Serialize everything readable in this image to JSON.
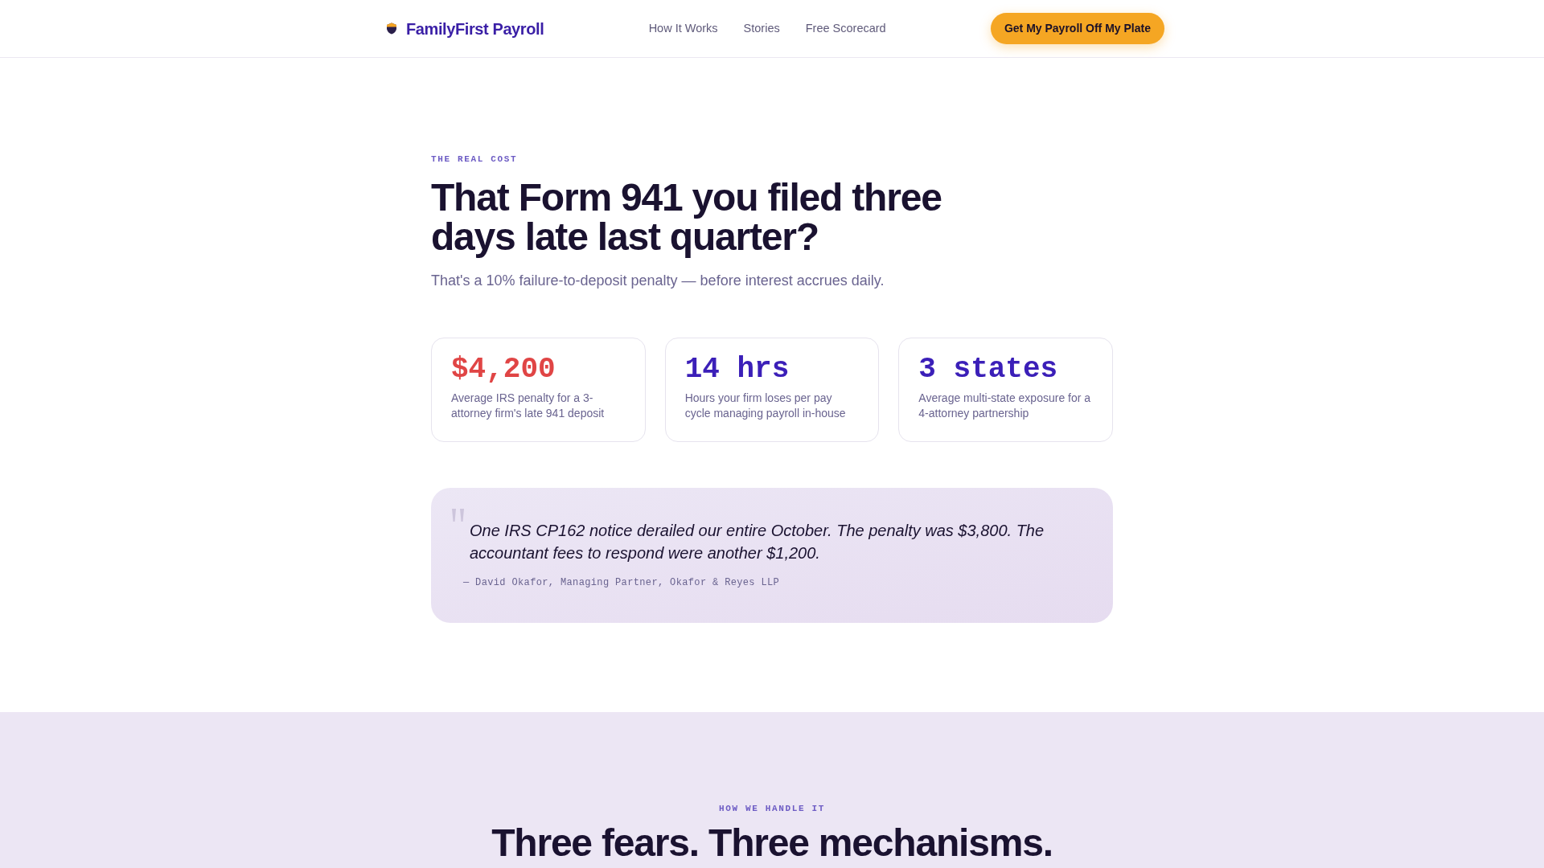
{
  "header": {
    "brand": "FamilyFirst Payroll",
    "nav": [
      "How It Works",
      "Stories",
      "Free Scorecard"
    ],
    "cta": "Get My Payroll Off My Plate"
  },
  "hero": {
    "eyebrow": "THE REAL COST",
    "title": "That Form 941 you filed three days late last quarter?",
    "subtitle": "That's a 10% failure-to-deposit penalty — before interest accrues daily."
  },
  "stats": [
    {
      "value": "$4,200",
      "caption": "Average IRS penalty for a 3-attorney firm's late 941 deposit",
      "color": "#e04545"
    },
    {
      "value": "14 hrs",
      "caption": "Hours your firm loses per pay cycle managing payroll in-house",
      "color": "#3b1fb8"
    },
    {
      "value": "3 states",
      "caption": "Average multi-state exposure for a 4-attorney partnership",
      "color": "#3b1fb8"
    }
  ],
  "quote": {
    "text": "One IRS CP162 notice derailed our entire October. The penalty was $3,800. The accountant fees to respond were another $1,200.",
    "attribution": "— David Okafor, Managing Partner, Okafor & Reyes LLP"
  },
  "mechanisms": {
    "eyebrow": "HOW WE HANDLE IT",
    "title": "Three fears. Three mechanisms."
  }
}
